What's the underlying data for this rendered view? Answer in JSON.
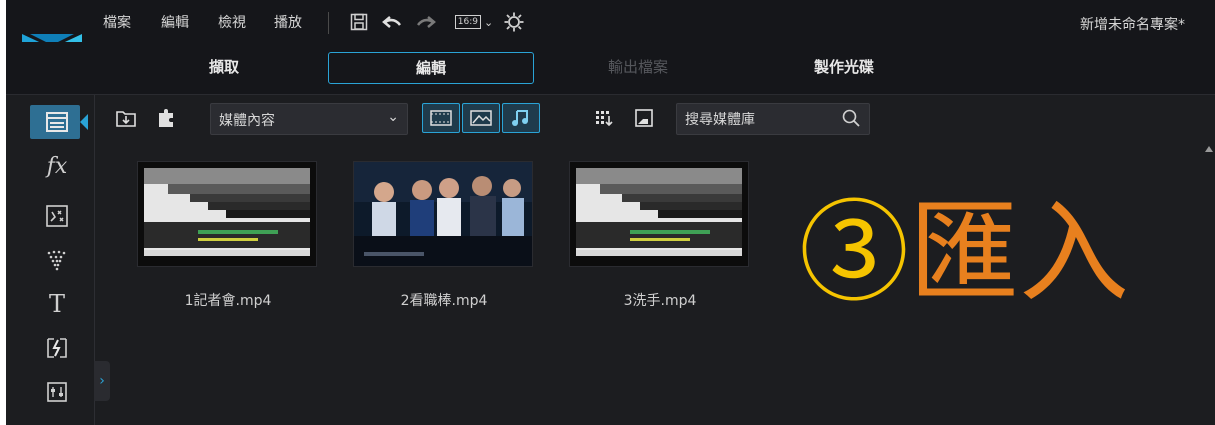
{
  "menu": {
    "items": [
      "檔案",
      "編輯",
      "檢視",
      "播放"
    ]
  },
  "toolbar": {
    "aspect_label": "16:9",
    "icons": [
      "save-icon",
      "undo-icon",
      "redo-icon",
      "aspect-ratio-icon",
      "preferences-gear-icon"
    ]
  },
  "project": {
    "title": "新增未命名專案*"
  },
  "tabs": [
    {
      "label": "擷取",
      "state": "normal"
    },
    {
      "label": "編輯",
      "state": "active"
    },
    {
      "label": "輸出檔案",
      "state": "disabled"
    },
    {
      "label": "製作光碟",
      "state": "normal"
    }
  ],
  "sidebar": {
    "icons": [
      "media-room-icon",
      "fx-icon",
      "pip-objects-icon",
      "particle-icon",
      "title-icon",
      "transition-icon",
      "audio-mixing-icon"
    ],
    "fx_label": "fx",
    "title_label": "T"
  },
  "media_toolbar": {
    "dropdown_value": "媒體內容",
    "search_placeholder": "搜尋媒體庫"
  },
  "clips": [
    {
      "label": "1記者會.mp4"
    },
    {
      "label": "2看職棒.mp4"
    },
    {
      "label": "3洗手.mp4"
    }
  ],
  "annotation": {
    "number": "③",
    "text": "匯入"
  },
  "colors": {
    "accent": "#2aa3d6",
    "annotation_text": "#e8801e",
    "annotation_number": "#f5c400",
    "background": "#1c1d20"
  }
}
